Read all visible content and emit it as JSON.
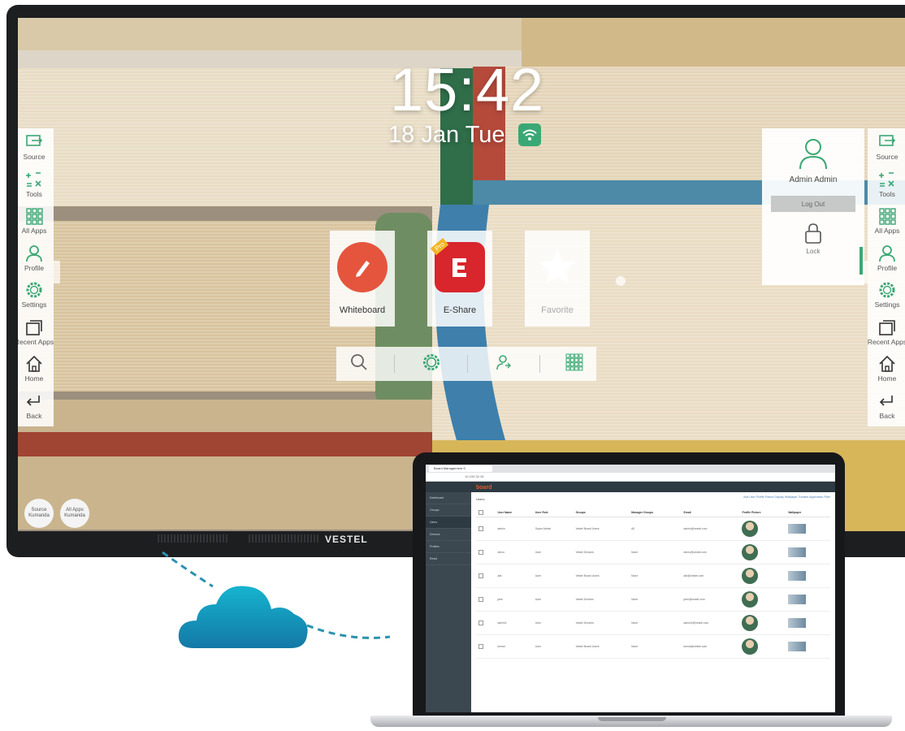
{
  "monitor": {
    "brand": "VESTEL",
    "clock": {
      "time": "15:42",
      "date": "18 Jan Tue"
    }
  },
  "sidebar": {
    "items": [
      {
        "label": "Source",
        "icon": "source-icon"
      },
      {
        "label": "Tools",
        "icon": "tools-icon"
      },
      {
        "label": "All Apps",
        "icon": "grid-icon"
      },
      {
        "label": "Profile",
        "icon": "profile-icon"
      },
      {
        "label": "Settings",
        "icon": "gear-icon"
      },
      {
        "label": "Recent Apps",
        "icon": "recent-apps-icon"
      },
      {
        "label": "Home",
        "icon": "home-icon"
      },
      {
        "label": "Back",
        "icon": "back-icon"
      }
    ]
  },
  "apps": [
    {
      "label": "Whiteboard",
      "icon": "whiteboard-icon",
      "color": "#e5553d"
    },
    {
      "label": "E-Share",
      "icon": "eshare-icon",
      "color": "#d9252c",
      "badge": "Pro"
    },
    {
      "label": "Favorite",
      "icon": "star-icon",
      "color": "#ffffff"
    }
  ],
  "bottombar": [
    "search-icon",
    "gear-icon",
    "user-switch-icon",
    "grid-icon"
  ],
  "profile_popup": {
    "name": "Admin Admin",
    "logout": "Log Out",
    "lock": "Lock"
  },
  "remote_buttons": [
    {
      "label": "Source Kumanda"
    },
    {
      "label": "All Apps Kumanda"
    }
  ],
  "laptop": {
    "tab_title": "Board Management S",
    "url": "10.100.32.18",
    "logo": "board",
    "nav": [
      "Dashboard",
      "Groups",
      "Users",
      "Devices",
      "Profiles",
      "Reset"
    ],
    "section": "Users",
    "actions": "Add User   Profile Picture   Display Wallpaper   Transfer Application   Filter",
    "columns": [
      "User Name",
      "User Role",
      "Groups",
      "Manager Groups",
      "Email",
      "Profile Picture",
      "Wallpaper"
    ],
    "rows": [
      {
        "name": "admin",
        "role": "Super Admin",
        "group": "Vestel Board Users",
        "manager": "All",
        "email": "admin@vestel.com"
      },
      {
        "name": "demo",
        "role": "User",
        "group": "Vestel Devices",
        "manager": "None",
        "email": "demo@vestel.com"
      },
      {
        "name": "alik",
        "role": "User",
        "group": "Vestel Board Users",
        "manager": "None",
        "email": "alik@vestel.com"
      },
      {
        "name": "jane",
        "role": "User",
        "group": "Vestel Devices",
        "manager": "None",
        "email": "jane@vestel.com"
      },
      {
        "name": "admin2",
        "role": "User",
        "group": "Vestel Devices",
        "manager": "None",
        "email": "admin2@vestel.com"
      },
      {
        "name": "kemal",
        "role": "User",
        "group": "Vestel Board Users",
        "manager": "None",
        "email": "kemal@vestel.com"
      }
    ]
  },
  "colors": {
    "accent": "#3aa874",
    "cloud": "#1ba3c6",
    "nav": "#3b4850"
  }
}
